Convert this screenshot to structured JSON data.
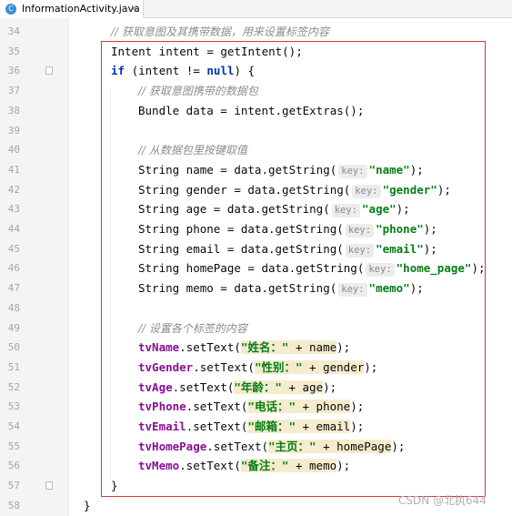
{
  "tab": {
    "icon_letter": "C",
    "file_name": "InformationActivity.java",
    "close_glyph": "×"
  },
  "lines": [
    {
      "n": "34",
      "indent": 2,
      "tokens": [
        {
          "t": "// 获取意图及其携带数据，用来设置标签内容",
          "c": "comment"
        }
      ]
    },
    {
      "n": "35",
      "indent": 2,
      "tokens": [
        {
          "t": "Intent intent = getIntent();"
        }
      ]
    },
    {
      "n": "36",
      "indent": 2,
      "fold": true,
      "tokens": [
        {
          "t": "if",
          "c": "kw"
        },
        {
          "t": " (intent != "
        },
        {
          "t": "null",
          "c": "kw"
        },
        {
          "t": ") {"
        }
      ]
    },
    {
      "n": "37",
      "indent": 3,
      "tokens": [
        {
          "t": "// 获取意图携带的数据包",
          "c": "comment"
        }
      ]
    },
    {
      "n": "38",
      "indent": 3,
      "tokens": [
        {
          "t": "Bundle data = intent.getExtras();"
        }
      ]
    },
    {
      "n": "39",
      "indent": 0,
      "tokens": []
    },
    {
      "n": "40",
      "indent": 3,
      "tokens": [
        {
          "t": "// 从数据包里按键取值",
          "c": "comment"
        }
      ]
    },
    {
      "n": "41",
      "indent": 3,
      "tokens": [
        {
          "t": "String name = data.getString("
        },
        {
          "t": "key:",
          "c": "hint"
        },
        {
          "t": "\"name\"",
          "c": "str"
        },
        {
          "t": ");"
        }
      ]
    },
    {
      "n": "42",
      "indent": 3,
      "tokens": [
        {
          "t": "String gender = data.getString("
        },
        {
          "t": "key:",
          "c": "hint"
        },
        {
          "t": "\"gender\"",
          "c": "str"
        },
        {
          "t": ");"
        }
      ]
    },
    {
      "n": "43",
      "indent": 3,
      "tokens": [
        {
          "t": "String age = data.getString("
        },
        {
          "t": "key:",
          "c": "hint"
        },
        {
          "t": "\"age\"",
          "c": "str"
        },
        {
          "t": ");"
        }
      ]
    },
    {
      "n": "44",
      "indent": 3,
      "tokens": [
        {
          "t": "String phone = data.getString("
        },
        {
          "t": "key:",
          "c": "hint"
        },
        {
          "t": "\"phone\"",
          "c": "str"
        },
        {
          "t": ");"
        }
      ]
    },
    {
      "n": "45",
      "indent": 3,
      "tokens": [
        {
          "t": "String email = data.getString("
        },
        {
          "t": "key:",
          "c": "hint"
        },
        {
          "t": "\"email\"",
          "c": "str"
        },
        {
          "t": ");"
        }
      ]
    },
    {
      "n": "46",
      "indent": 3,
      "tokens": [
        {
          "t": "String homePage = data.getString("
        },
        {
          "t": "key:",
          "c": "hint"
        },
        {
          "t": "\"home_page\"",
          "c": "str"
        },
        {
          "t": ");"
        }
      ]
    },
    {
      "n": "47",
      "indent": 3,
      "tokens": [
        {
          "t": "String memo = data.getString("
        },
        {
          "t": "key:",
          "c": "hint"
        },
        {
          "t": "\"memo\"",
          "c": "str"
        },
        {
          "t": ");"
        }
      ]
    },
    {
      "n": "48",
      "indent": 0,
      "tokens": []
    },
    {
      "n": "49",
      "indent": 3,
      "tokens": [
        {
          "t": "// 设置各个标签的内容",
          "c": "comment"
        }
      ]
    },
    {
      "n": "50",
      "indent": 3,
      "tokens": [
        {
          "t": "tvName",
          "c": "field"
        },
        {
          "t": ".setText("
        },
        {
          "t": "\"姓名：\"",
          "c": "str strbg"
        },
        {
          "t": " + name",
          "c": "strbg"
        },
        {
          "t": ");"
        }
      ]
    },
    {
      "n": "51",
      "indent": 3,
      "tokens": [
        {
          "t": "tvGender",
          "c": "field"
        },
        {
          "t": ".setText("
        },
        {
          "t": "\"性别：\"",
          "c": "str strbg"
        },
        {
          "t": " + gender",
          "c": "strbg"
        },
        {
          "t": ");"
        }
      ]
    },
    {
      "n": "52",
      "indent": 3,
      "tokens": [
        {
          "t": "tvAge",
          "c": "field"
        },
        {
          "t": ".setText("
        },
        {
          "t": "\"年龄：\"",
          "c": "str strbg"
        },
        {
          "t": " + age",
          "c": "strbg"
        },
        {
          "t": ");"
        }
      ]
    },
    {
      "n": "53",
      "indent": 3,
      "tokens": [
        {
          "t": "tvPhone",
          "c": "field"
        },
        {
          "t": ".setText("
        },
        {
          "t": "\"电话：\"",
          "c": "str strbg"
        },
        {
          "t": " + phone",
          "c": "strbg"
        },
        {
          "t": ");"
        }
      ]
    },
    {
      "n": "54",
      "indent": 3,
      "tokens": [
        {
          "t": "tvEmail",
          "c": "field"
        },
        {
          "t": ".setText("
        },
        {
          "t": "\"邮箱：\"",
          "c": "str strbg"
        },
        {
          "t": " + email",
          "c": "strbg"
        },
        {
          "t": ");"
        }
      ]
    },
    {
      "n": "55",
      "indent": 3,
      "tokens": [
        {
          "t": "tvHomePage",
          "c": "field"
        },
        {
          "t": ".setText("
        },
        {
          "t": "\"主页：\"",
          "c": "str strbg"
        },
        {
          "t": " + homePage",
          "c": "strbg"
        },
        {
          "t": ");"
        }
      ]
    },
    {
      "n": "56",
      "indent": 3,
      "tokens": [
        {
          "t": "tvMemo",
          "c": "field"
        },
        {
          "t": ".setText("
        },
        {
          "t": "\"备注：\"",
          "c": "str strbg"
        },
        {
          "t": " + memo",
          "c": "strbg"
        },
        {
          "t": ");"
        }
      ]
    },
    {
      "n": "57",
      "indent": 2,
      "fold": true,
      "tokens": [
        {
          "t": "}"
        }
      ]
    },
    {
      "n": "58",
      "indent": 1,
      "tokens": [
        {
          "t": "}"
        }
      ]
    }
  ],
  "watermark": "CSDN @北执644",
  "colors": {
    "keyword": "#0033b3",
    "field": "#871094",
    "string": "#067d17",
    "comment": "#8c8c8c",
    "highlight_box": "#d3383a"
  }
}
